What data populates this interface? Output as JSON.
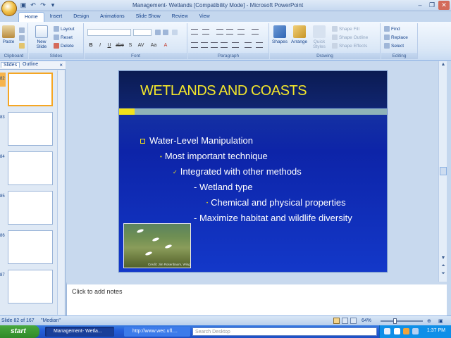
{
  "window": {
    "title": "Management- Wetlands [Compatibility Mode] - Microsoft PowerPoint",
    "controls": [
      "–",
      "❐",
      "✕"
    ]
  },
  "ribbon": {
    "tabs": [
      "Home",
      "Insert",
      "Design",
      "Animations",
      "Slide Show",
      "Review",
      "View"
    ],
    "active_tab": "Home",
    "groups": {
      "clipboard": {
        "label": "Clipboard",
        "paste": "Paste"
      },
      "slides": {
        "label": "Slides",
        "new_slide": "New Slide",
        "layout": "Layout",
        "reset": "Reset",
        "delete": "Delete"
      },
      "font": {
        "label": "Font",
        "format_letters": [
          "B",
          "I",
          "U",
          "abe",
          "S",
          "AV",
          "Aa",
          "A"
        ]
      },
      "paragraph": {
        "label": "Paragraph"
      },
      "drawing": {
        "label": "Drawing",
        "shapes": "Shapes",
        "arrange": "Arrange",
        "quick_styles": "Quick Styles",
        "shape_fill": "Shape Fill",
        "shape_outline": "Shape Outline",
        "shape_effects": "Shape Effects"
      },
      "editing": {
        "label": "Editing",
        "find": "Find",
        "replace": "Replace",
        "select": "Select"
      }
    }
  },
  "left_pane": {
    "tabs": [
      "Slides",
      "Outline"
    ],
    "slide_numbers": [
      "82",
      "83",
      "84",
      "85",
      "86",
      "87"
    ]
  },
  "slide": {
    "title": "WETLANDS AND COASTS",
    "bullets": [
      {
        "text": "Water-Level Manipulation",
        "level": 0
      },
      {
        "text": "Most important technique",
        "level": 1
      },
      {
        "text": "Integrated with other methods",
        "level": 2
      },
      {
        "text": "- Wetland type",
        "level": 3
      },
      {
        "text": "Chemical and physical properties",
        "level": 4
      },
      {
        "text": "- Maximize habitat and wildlife diversity",
        "level": 3
      }
    ],
    "photo_credit": "Credit: Jim Rosenbaum, Wing"
  },
  "notes": {
    "placeholder": "Click to add notes"
  },
  "status": {
    "slide_of": "Slide 82 of 167",
    "theme": "\"Median\"",
    "zoom": "64%"
  },
  "taskbar": {
    "start": "start",
    "tasks": [
      "Management- Wetla...",
      "http://www.wec.ufl...."
    ],
    "search_placeholder": "Search Desktop",
    "clock": "1:37 PM"
  },
  "colors": {
    "slide_title": "#f3e62b",
    "slide_bg": "#0d24a8",
    "ribbon": "#dbe8f7",
    "taskbar": "#245edb"
  }
}
